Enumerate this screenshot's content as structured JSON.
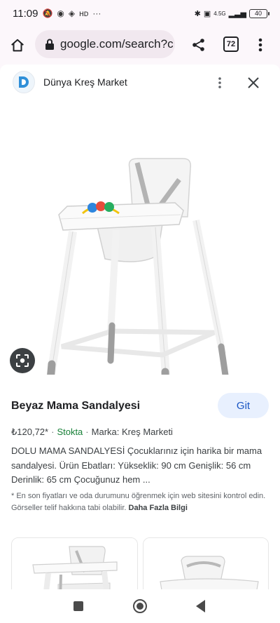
{
  "status_bar": {
    "time": "11:09",
    "signal_text": "4.5G",
    "battery": "40"
  },
  "browser": {
    "url": "google.com/search?c",
    "tab_count": "72"
  },
  "source": {
    "name": "Dünya Kreş Market"
  },
  "product": {
    "title": "Beyaz Mama Sandalyesi",
    "go_label": "Git",
    "price": "₺120,72*",
    "stock": "Stokta",
    "brand": "Marka: Kreş Marketi",
    "description": "DOLU MAMA SANDALYESİ Çocuklarınız için harika bir mama sandalyesi. Ürün Ebatları: Yükseklik: 90 cm Genişlik: 56 cm Derinlik: 65 cm Çocuğunuz hem ...",
    "disclaimer": "* En son fiyatları ve oda durumunu öğrenmek için web sitesini kontrol edin. Görseller telif hakkına tabi olabilir.",
    "more_info": "Daha Fazla Bilgi"
  },
  "colors": {
    "accent": "#1a56c4",
    "stock_green": "#188038"
  }
}
